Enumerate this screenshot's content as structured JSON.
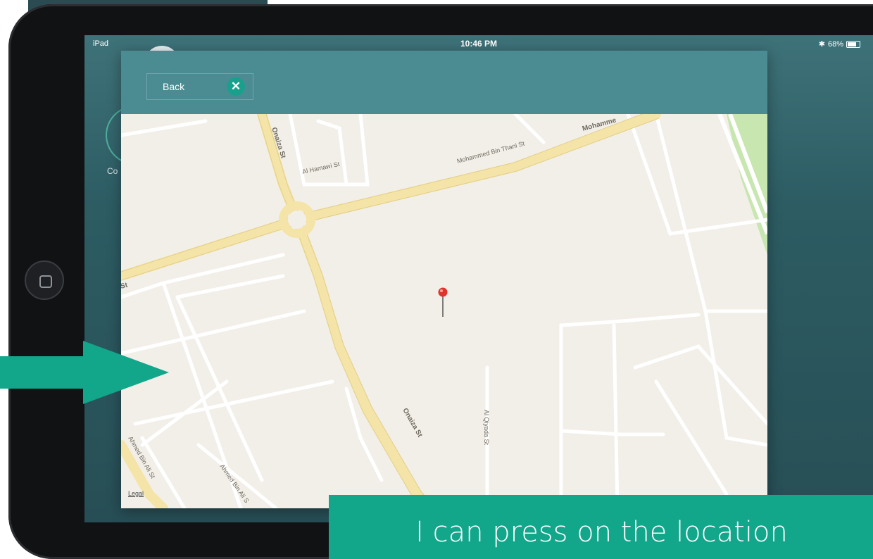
{
  "status_bar": {
    "device": "iPad",
    "time": "10:46 PM",
    "battery": "68%"
  },
  "behind": {
    "label": "Co"
  },
  "modal": {
    "back_label": "Back",
    "close_icon": "close-icon"
  },
  "map": {
    "legal": "Legal",
    "streets": {
      "onaiza_1": "Onaiza St",
      "onaiza_2": "Onaiza St",
      "al_hamawi": "Al Hamawi St",
      "mohammed_bin_thani": "Mohammed Bin Thani St",
      "mohammed_cut": "Mohamme",
      "al_qiyada": "Al Qiyada St",
      "ahmed_bin_ali_1": "Ahmed Bin Ali St",
      "ahmed_bin_ali_2": "Ahmed Bin Ali S",
      "st_left": "St"
    }
  },
  "annotation": {
    "callout_text": "I can press on the location",
    "accent_color": "#12a68b"
  }
}
